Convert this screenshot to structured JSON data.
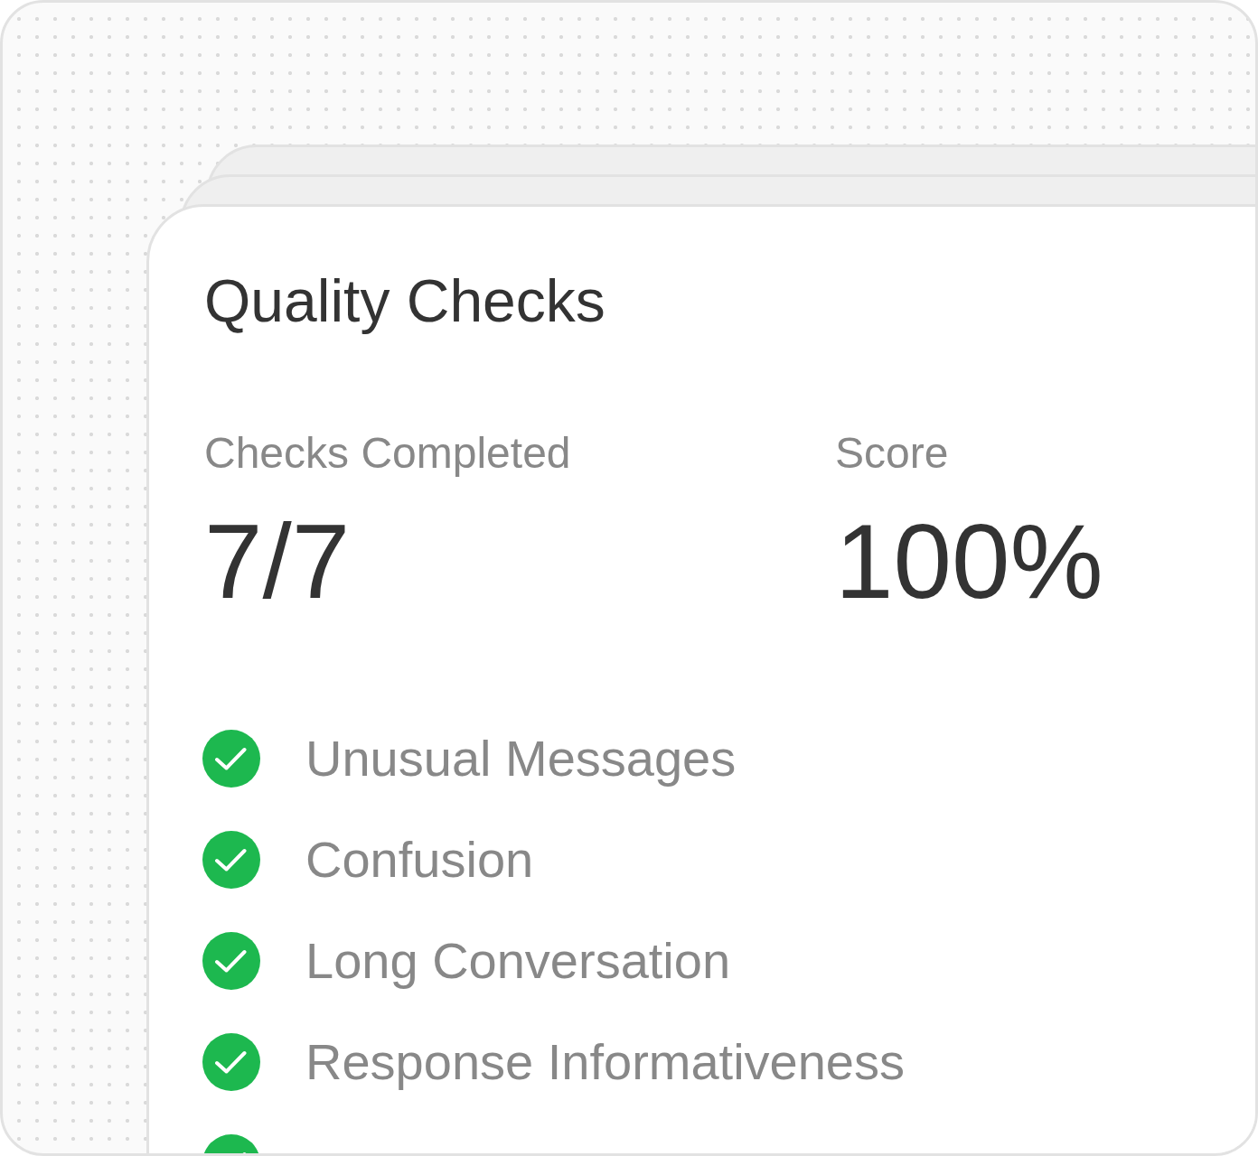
{
  "title": "Quality Checks",
  "stats": [
    {
      "label": "Checks Completed",
      "value": "7/7"
    },
    {
      "label": "Score",
      "value": "100%"
    }
  ],
  "checks": [
    {
      "label": "Unusual Messages",
      "passed": true
    },
    {
      "label": "Confusion",
      "passed": true
    },
    {
      "label": "Long Conversation",
      "passed": true
    },
    {
      "label": "Response Informativeness",
      "passed": true
    },
    {
      "passed": true
    }
  ]
}
